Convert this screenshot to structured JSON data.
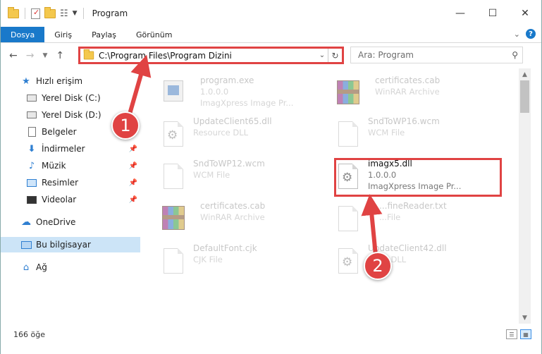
{
  "window": {
    "title": "Program",
    "controls": {
      "minimize": "—",
      "maximize": "☐",
      "close": "✕"
    }
  },
  "ribbon": {
    "tabs": [
      {
        "label": "Dosya",
        "active": true
      },
      {
        "label": "Giriş"
      },
      {
        "label": "Paylaş"
      },
      {
        "label": "Görünüm"
      }
    ],
    "help": "?"
  },
  "nav": {
    "address": "C:\\Program Files\\Program Dizini",
    "search_placeholder": "Ara: Program"
  },
  "sidebar": {
    "items": [
      {
        "label": "Hızlı erişim",
        "icon": "star-icon"
      },
      {
        "label": "Yerel Disk (C:)",
        "icon": "disk-icon"
      },
      {
        "label": "Yerel Disk (D:)",
        "icon": "disk-icon"
      },
      {
        "label": "Belgeler",
        "icon": "document-icon"
      },
      {
        "label": "İndirmeler",
        "icon": "download-icon",
        "pinned": true
      },
      {
        "label": "Müzik",
        "icon": "music-icon",
        "pinned": true
      },
      {
        "label": "Resimler",
        "icon": "pictures-icon",
        "pinned": true
      },
      {
        "label": "Videolar",
        "icon": "videos-icon",
        "pinned": true
      },
      {
        "label": "OneDrive",
        "icon": "cloud-icon"
      },
      {
        "label": "Bu bilgisayar",
        "icon": "computer-icon",
        "selected": true
      },
      {
        "label": "Ağ",
        "icon": "network-icon"
      }
    ]
  },
  "files": [
    {
      "name": "program.exe",
      "line2": "1.0.0.0",
      "line3": "ImagXpress Image Pr...",
      "type": "exe"
    },
    {
      "name": "certificates.cab",
      "line2": "WinRAR Archive",
      "type": "rar"
    },
    {
      "name": "UpdateClient65.dll",
      "line2": "Resource DLL",
      "type": "dll"
    },
    {
      "name": "SndToWP16.wcm",
      "line2": "WCM File",
      "type": "file"
    },
    {
      "name": "SndToWP12.wcm",
      "line2": "WCM File",
      "type": "file"
    },
    {
      "name": "imagx5.dll",
      "line2": "1.0.0.0",
      "line3": "ImagXpress Image Pr...",
      "type": "dll",
      "highlighted": true
    },
    {
      "name": "certificates.cab",
      "line2": "WinRAR Archive",
      "type": "rar"
    },
    {
      "name": "...fineReader.txt",
      "line2": "...File",
      "type": "file"
    },
    {
      "name": "DefaultFont.cjk",
      "line2": "CJK File",
      "type": "file"
    },
    {
      "name": "UpdateClient42.dll",
      "line2": "...rce DLL",
      "type": "dll"
    }
  ],
  "status": {
    "count": "166 öğe"
  },
  "annotations": {
    "step1": "1",
    "step2": "2",
    "color": "#e04343"
  }
}
